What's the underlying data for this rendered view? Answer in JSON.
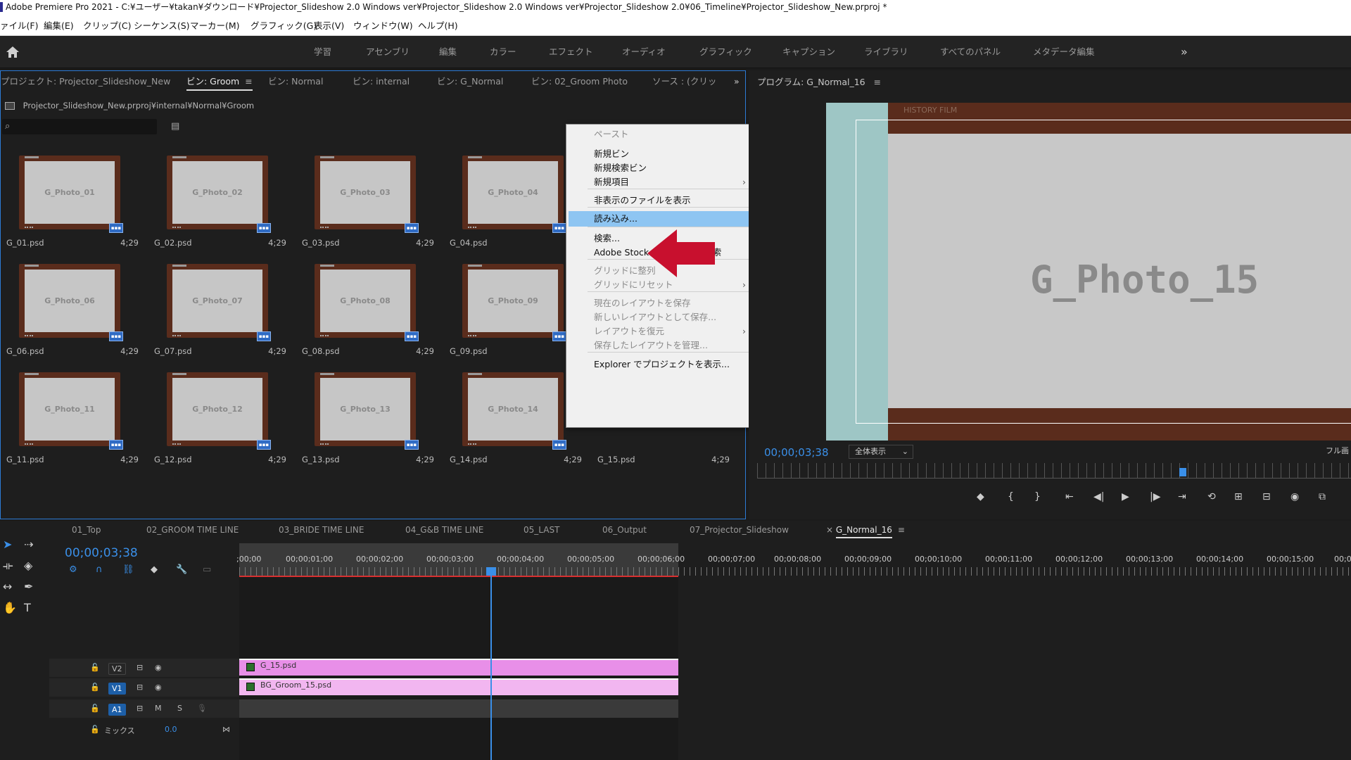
{
  "window": {
    "title": "Adobe Premiere Pro 2021 - C:¥ユーザー¥takan¥ダウンロード¥Projector_Slideshow 2.0 Windows ver¥Projector_Slideshow 2.0 Windows ver¥Projector_Slideshow 2.0¥06_Timeline¥Projector_Slideshow_New.prproj *"
  },
  "menu": [
    "ァイル(F)",
    "編集(E)",
    "クリップ(C)",
    "シーケンス(S)",
    "マーカー(M)",
    "グラフィック(G)",
    "表示(V)",
    "ウィンドウ(W)",
    "ヘルプ(H)"
  ],
  "workspaces": [
    "学習",
    "アセンブリ",
    "編集",
    "カラー",
    "エフェクト",
    "オーディオ",
    "グラフィック",
    "キャプション",
    "ライブラリ",
    "すべてのパネル",
    "メタデータ編集"
  ],
  "workspaces_more": "»",
  "project_panel": {
    "tabs": [
      "プロジェクト: Projector_Slideshow_New",
      "ビン: Groom",
      "ビン: Normal",
      "ビン: internal",
      "ビン: G_Normal",
      "ビン: 02_Groom Photo",
      "ソース : (クリッ"
    ],
    "active_tab": 1,
    "more": "»",
    "path": "Projector_Slideshow_New.prproj¥internal¥Normal¥Groom",
    "items": [
      {
        "label": "G_Photo_01",
        "file": "G_01.psd",
        "duration": "4;29"
      },
      {
        "label": "G_Photo_02",
        "file": "G_02.psd",
        "duration": "4;29"
      },
      {
        "label": "G_Photo_03",
        "file": "G_03.psd",
        "duration": "4;29"
      },
      {
        "label": "G_Photo_04",
        "file": "G_04.psd",
        "duration": ""
      },
      {
        "label": "G_Photo_06",
        "file": "G_06.psd",
        "duration": "4;29"
      },
      {
        "label": "G_Photo_07",
        "file": "G_07.psd",
        "duration": "4;29"
      },
      {
        "label": "G_Photo_08",
        "file": "G_08.psd",
        "duration": "4;29"
      },
      {
        "label": "G_Photo_09",
        "file": "G_09.psd",
        "duration": ""
      },
      {
        "label": "G_Photo_11",
        "file": "G_11.psd",
        "duration": "4;29"
      },
      {
        "label": "G_Photo_12",
        "file": "G_12.psd",
        "duration": "4;29"
      },
      {
        "label": "G_Photo_13",
        "file": "G_13.psd",
        "duration": "4;29"
      },
      {
        "label": "G_Photo_14",
        "file": "G_14.psd",
        "duration": "4;29"
      }
    ],
    "extra_item": {
      "file": "G_15.psd",
      "duration": "4;29"
    }
  },
  "context_menu": {
    "items": [
      {
        "label": "ペースト",
        "disabled": true
      },
      {
        "label": "新規ビン"
      },
      {
        "label": "新規検索ビン"
      },
      {
        "label": "新規項目",
        "submenu": true
      },
      {
        "label": "非表示のファイルを表示"
      },
      {
        "label": "読み込み...",
        "highlighted": true
      },
      {
        "label": "検索..."
      },
      {
        "label": "Adobe Stock オーディオを検索"
      },
      {
        "label": "グリッドに整列",
        "disabled": true
      },
      {
        "label": "グリッドにリセット",
        "disabled": true,
        "submenu": true
      },
      {
        "label": "現在のレイアウトを保存",
        "disabled": true
      },
      {
        "label": "新しいレイアウトとして保存...",
        "disabled": true
      },
      {
        "label": "レイアウトを復元",
        "disabled": true,
        "submenu": true
      },
      {
        "label": "保存したレイアウトを管理...",
        "disabled": true
      },
      {
        "label": "Explorer でプロジェクトを表示..."
      }
    ],
    "submenu_glyph": "›"
  },
  "program_monitor": {
    "title": "プログラム: G_Normal_16",
    "video_label": "G_Photo_15",
    "strip_text": "HISTORY FILM",
    "timecode": "00;00;03;38",
    "fit": "全体表示",
    "quality": "フル画"
  },
  "timeline": {
    "tabs": [
      "01_Top",
      "02_GROOM TIME LINE",
      "03_BRIDE TIME LINE",
      "04_G&B TIME LINE",
      "05_LAST",
      "06_Output",
      "07_Projector_Slideshow",
      "G_Normal_16"
    ],
    "active_tab": 7,
    "close_glyph": "×",
    "timecode": "00;00;03;38",
    "ruler": [
      ";00;00",
      "00;00;01;00",
      "00;00;02;00",
      "00;00;03;00",
      "00;00;04;00",
      "00;00;05;00",
      "00;00;06;00",
      "00;00;07;00",
      "00;00;08;00",
      "00;00;09;00",
      "00;00;10;00",
      "00;00;11;00",
      "00;00;12;00",
      "00;00;13;00",
      "00;00;14;00",
      "00;00;15;00",
      "00;0"
    ],
    "tracks": {
      "v2": "V2",
      "v1": "V1",
      "a1": "A1",
      "m": "M",
      "s": "S",
      "mix": "ミックス",
      "mix_value": "0.0"
    },
    "clips": {
      "v2": "G_15.psd",
      "v1": "BG_Groom_15.psd"
    }
  },
  "colors": {
    "accent": "#2d7bd6",
    "timecode": "#3a8fe8",
    "clip_v2": "#e88fe8",
    "clip_v1": "#f2b6f0",
    "arrow": "#c8102e",
    "highlight": "#8ec5f2"
  }
}
